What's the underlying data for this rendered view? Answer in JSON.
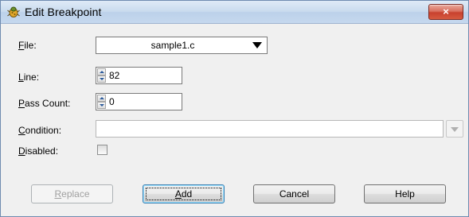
{
  "window": {
    "title": "Edit Breakpoint",
    "close_label": "×",
    "app_icon": "bug-icon",
    "close_color": "#c8412f"
  },
  "form": {
    "file": {
      "label": "File:",
      "mnemonic": "F",
      "rest": "ile:",
      "value": "sample1.c",
      "icon": "dropdown-arrow-icon"
    },
    "line": {
      "label": "Line:",
      "mnemonic": "L",
      "rest": "ine:",
      "value": "82",
      "icon": "spinner-icon"
    },
    "pass_count": {
      "label": "Pass Count:",
      "mnemonic": "P",
      "rest": "ass Count:",
      "value": "0",
      "icon": "spinner-icon"
    },
    "condition": {
      "label": "Condition:",
      "mnemonic": "C",
      "rest": "ondition:",
      "value": "",
      "icon": "dropdown-arrow-icon"
    },
    "disabled": {
      "label": "Disabled:",
      "mnemonic": "D",
      "rest": "isabled:",
      "checked": false
    }
  },
  "buttons": {
    "replace": {
      "label": "Replace",
      "mnemonic": "R",
      "rest": "eplace",
      "enabled": false
    },
    "add": {
      "label": "Add",
      "mnemonic": "A",
      "rest": "dd",
      "default": true
    },
    "cancel": {
      "label": "Cancel"
    },
    "help": {
      "label": "Help"
    }
  }
}
